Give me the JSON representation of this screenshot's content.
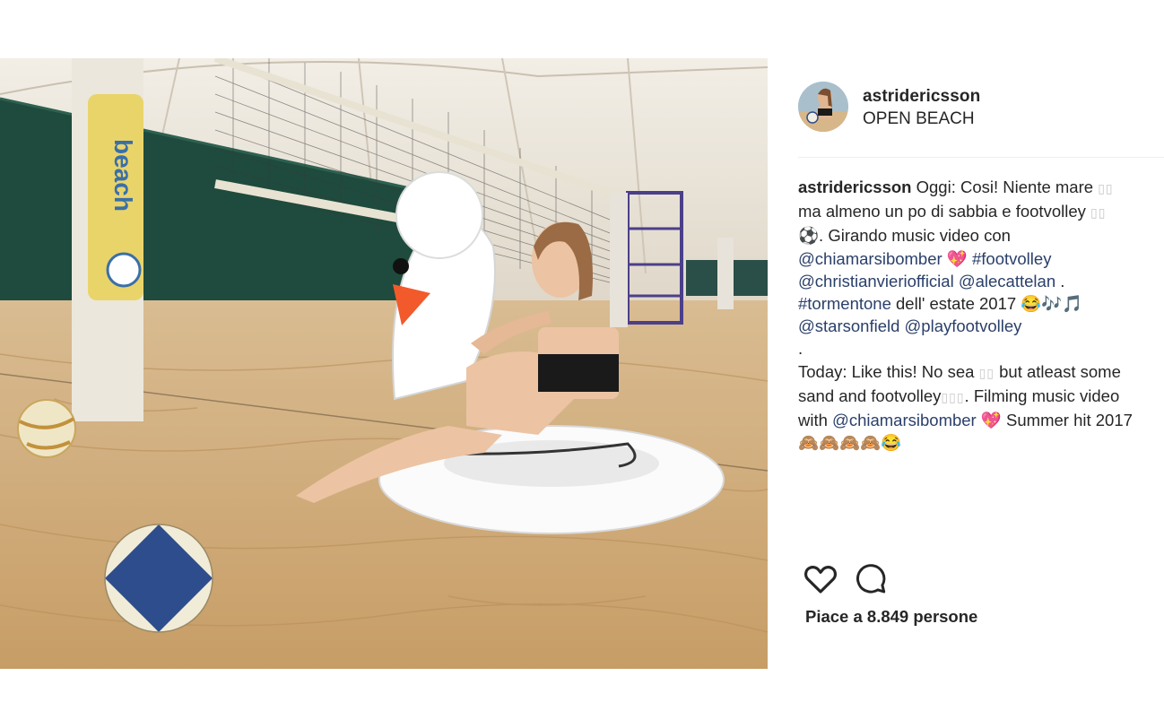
{
  "post": {
    "username": "astridericsson",
    "location": "OPEN BEACH",
    "caption": {
      "author": "astridericsson",
      "p1": "Oggi: Cosi! Niente mare",
      "p2": "ma almeno un po di sabbia e footvolley",
      "p3": "⚽. Girando music video con",
      "m_chiamarsi": "@chiamarsibomber",
      "heart": "💖",
      "h_footvolley": "#footvolley",
      "m_christian": "@christianvieriofficial",
      "m_ale": "@alecattelan",
      "dot": " .",
      "h_tormentone": "#tormentone",
      "p4": " dell' estate 2017 ",
      "emoji1": "😂🎶🎵",
      "m_stars": "@starsonfield",
      "m_play": "@playfootvolley",
      "sep": ".",
      "p5": "Today: Like this! No sea",
      "p6": " but atleast some sand and footvolley",
      "p7": ". Filming music video with ",
      "p8": " Summer hit 2017 ",
      "emoji2": "🙈🙈🙈🙈😂",
      "boxes2": "▯▯",
      "boxes3": "▯▯▯"
    },
    "likes_text": "Piace a 8.849 persone"
  },
  "icons": {
    "like": "heart-icon",
    "comment": "comment-icon"
  },
  "colors": {
    "text": "#262626",
    "link": "#2a3f6a",
    "sand": "#d6b07c",
    "net_wall": "#1f4a3c"
  }
}
